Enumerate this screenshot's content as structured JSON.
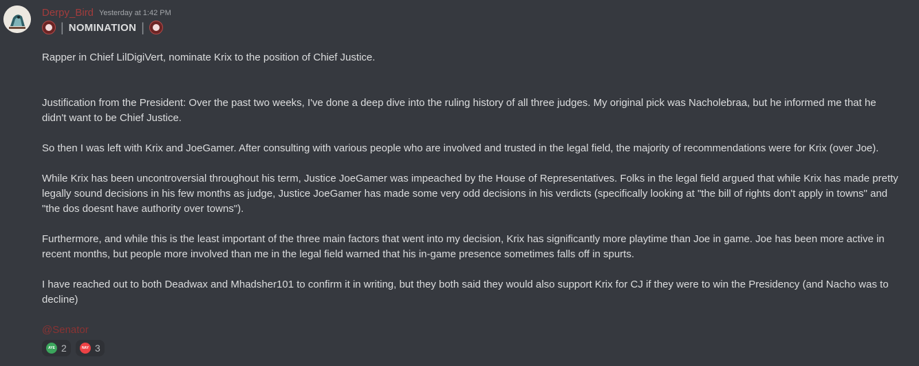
{
  "message": {
    "author": "Derpy_Bird",
    "timestamp": "Yesterday at 1:42 PM",
    "header_title": "NOMINATION",
    "header_separator": "|",
    "paragraphs": [
      "Rapper in Chief LilDigiVert, nominate Krix to the position of Chief Justice.",
      "Justification from the President: Over the past two weeks, I've done a deep dive into the ruling history of all three judges. My original pick was Nacholebraa, but he informed me that he didn't want to be Chief Justice.",
      "So then I was left with Krix and JoeGamer. After consulting with various people who are involved and trusted in the legal field, the majority of recommendations were for Krix (over Joe).",
      "While Krix has been uncontroversial throughout his term, Justice JoeGamer was impeached by the House of Representatives. Folks in the legal field argued that while Krix has made pretty legally sound decisions in his few months as judge, Justice JoeGamer has made some very odd decisions in his verdicts (specifically looking at \"the bill of rights don't apply in towns\" and \"the dos doesnt have authority over towns\").",
      "Furthermore, and while this is the least important of the three main factors that went into my decision, Krix has significantly more playtime than Joe in game. Joe has been more active in recent months, but people more involved than me in the legal field warned that his in-game presence sometimes falls off in spurts.",
      "I have reached out to both Deadwax and Mhadsher101 to confirm it in writing, but they both said they would also support Krix for CJ if they were to win the Presidency (and Nacho was to decline)"
    ],
    "mention": "@Senator",
    "reactions": [
      {
        "emoji_label": "AYE",
        "color": "#3ba55c",
        "count": "2"
      },
      {
        "emoji_label": "NAY",
        "color": "#ed4245",
        "count": "3"
      }
    ]
  }
}
